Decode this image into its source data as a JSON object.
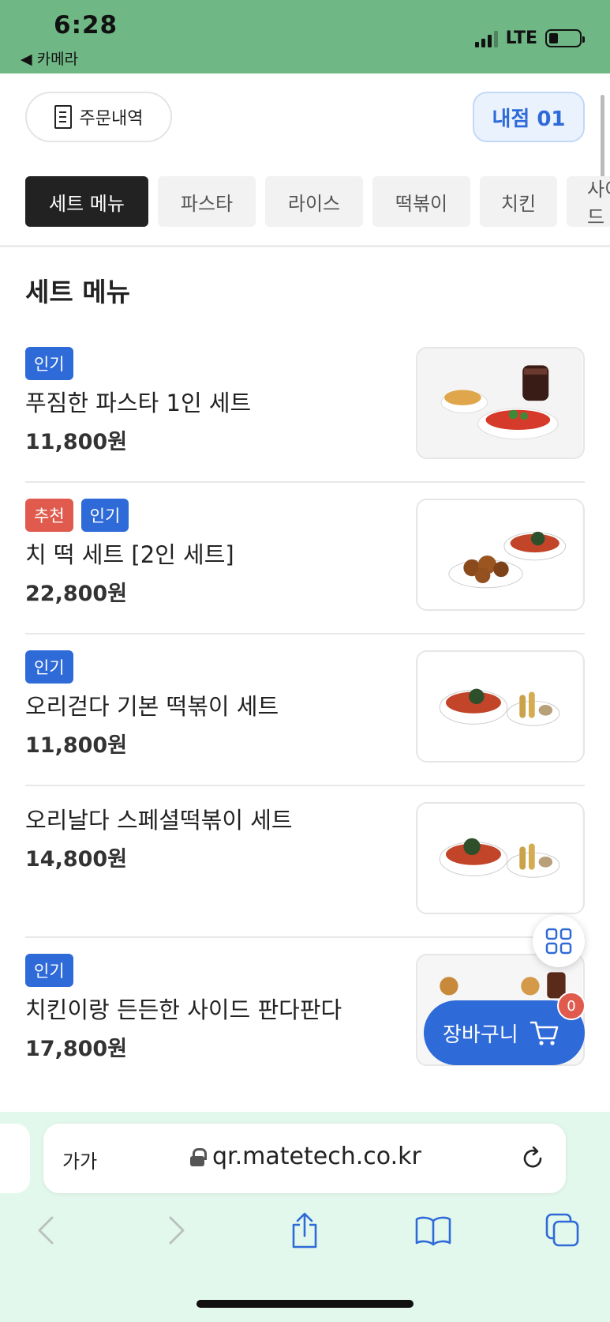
{
  "status_bar": {
    "time": "6:28",
    "back_app": "◀ 카메라",
    "network": "LTE"
  },
  "header": {
    "order_history_label": "주문내역",
    "table_label": "내점 01"
  },
  "categories": [
    {
      "label": "세트 메뉴",
      "active": true
    },
    {
      "label": "파스타",
      "active": false
    },
    {
      "label": "라이스",
      "active": false
    },
    {
      "label": "떡볶이",
      "active": false
    },
    {
      "label": "치킨",
      "active": false
    },
    {
      "label": "사이드",
      "active": false
    }
  ],
  "section": {
    "title": "세트 메뉴"
  },
  "menu_items": [
    {
      "badges": [
        "인기"
      ],
      "name": "푸짐한 파스타 1인 세트",
      "price": "11,800원"
    },
    {
      "badges": [
        "추천",
        "인기"
      ],
      "name": "치 떡 세트 [2인 세트]",
      "price": "22,800원"
    },
    {
      "badges": [
        "인기"
      ],
      "name": "오리걷다 기본 떡볶이 세트",
      "price": "11,800원"
    },
    {
      "badges": [],
      "name": "오리날다 스페셜떡볶이 세트",
      "price": "14,800원"
    },
    {
      "badges": [
        "인기"
      ],
      "name": "치킨이랑 든든한 사이드 판다판다",
      "price": "17,800원"
    }
  ],
  "cart": {
    "label": "장바구니",
    "count": "0"
  },
  "browser": {
    "text_size_label": "가가",
    "url": "qr.matetech.co.kr"
  },
  "colors": {
    "status_bar": "#6fb886",
    "accent_blue": "#2e6ad8",
    "badge_red": "#e05b4e",
    "browser_bar": "#e3f8ec"
  },
  "icons": {
    "order_history": "receipt-icon",
    "cart": "cart-icon",
    "grid": "grid-icon",
    "lock": "lock-icon",
    "reload": "reload-icon",
    "back": "chevron-left-icon",
    "forward": "chevron-right-icon",
    "share": "share-icon",
    "bookmarks": "book-icon",
    "tabs": "tabs-icon"
  }
}
